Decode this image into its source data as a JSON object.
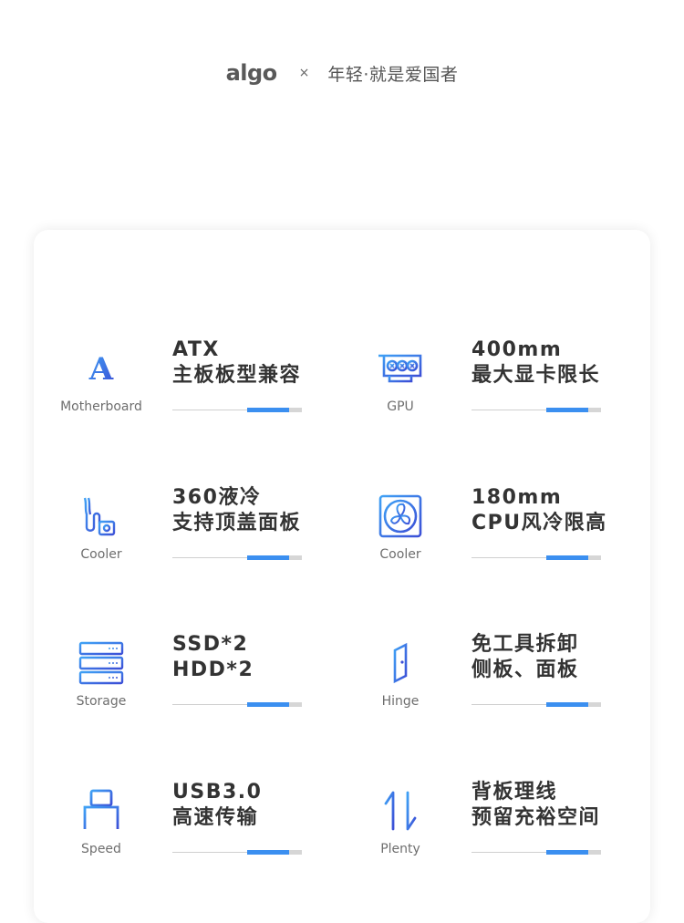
{
  "header": {
    "brand": "algo",
    "separator": "×",
    "slogan": "年轻·就是爱国者"
  },
  "features": [
    {
      "icon": "atx-letter-icon",
      "caption": "Motherboard",
      "title_1": "ATX",
      "title_2": "主板板型兼容"
    },
    {
      "icon": "gpu-card-icon",
      "caption": "GPU",
      "title_1": "400mm",
      "title_2": "最大显卡限长"
    },
    {
      "icon": "liquid-cooler-icon",
      "caption": "Cooler",
      "title_1": "360液冷",
      "title_2": "支持顶盖面板"
    },
    {
      "icon": "fan-icon",
      "caption": "Cooler",
      "title_1": "180mm",
      "title_2": "CPU风冷限高"
    },
    {
      "icon": "storage-drives-icon",
      "caption": "Storage",
      "title_1": "SSD*2",
      "title_2": "HDD*2"
    },
    {
      "icon": "side-panel-hinge-icon",
      "caption": "Hinge",
      "title_1": "免工具拆卸",
      "title_2": "侧板、面板"
    },
    {
      "icon": "usb-port-icon",
      "caption": "Speed",
      "title_1": "USB3.0",
      "title_2": "高速传输"
    },
    {
      "icon": "cable-management-arrows-icon",
      "caption": "Plenty",
      "title_1": "背板理线",
      "title_2": "预留充裕空间"
    }
  ],
  "colors": {
    "accent": "#3b8ff0",
    "icon_gradient_start": "#3fa1f5",
    "icon_gradient_end": "#3c4fd6",
    "text": "#333333",
    "caption": "#6e6e6e"
  }
}
